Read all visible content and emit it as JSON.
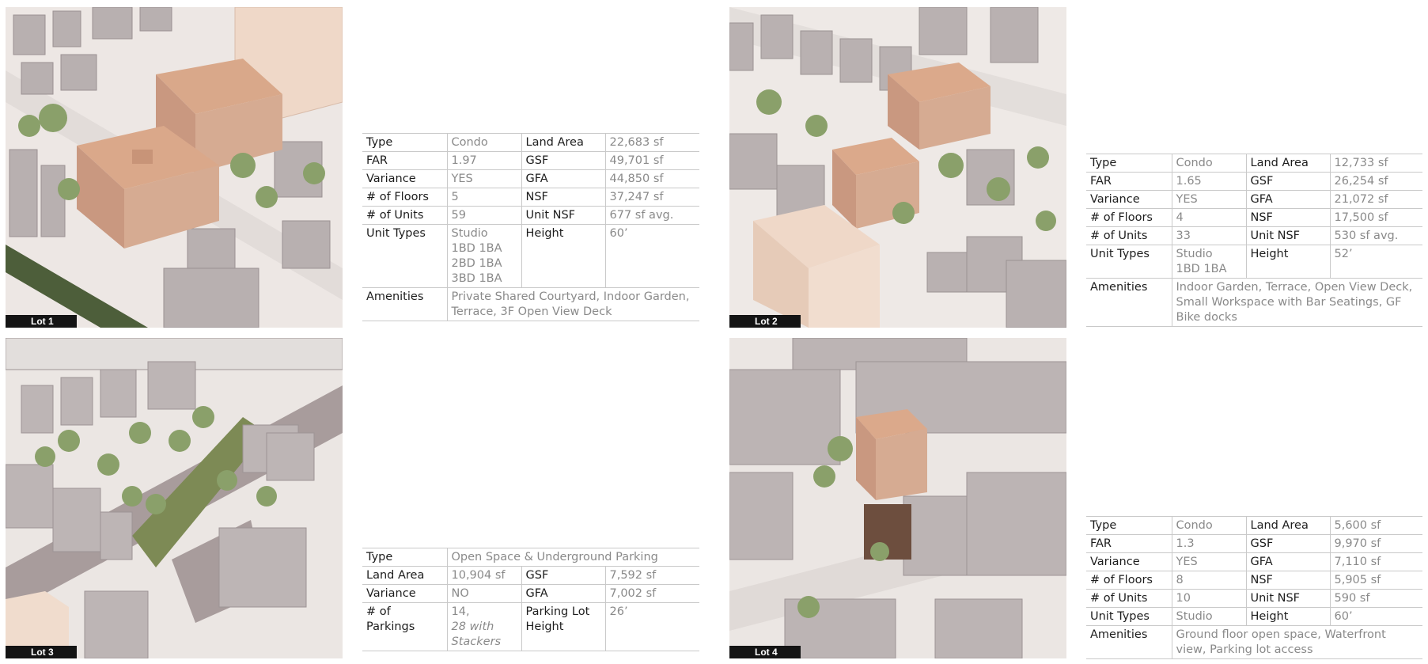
{
  "lots": [
    {
      "label": "Lot 1",
      "rows": [
        {
          "k1": "Type",
          "v1": "Condo",
          "k2": "Land Area",
          "v2": "22,683 sf"
        },
        {
          "k1": "FAR",
          "v1": "1.97",
          "k2": "GSF",
          "v2": "49,701 sf"
        },
        {
          "k1": "Variance",
          "v1": "YES",
          "k2": "GFA",
          "v2": "44,850 sf"
        },
        {
          "k1": "# of Floors",
          "v1": "5",
          "k2": "NSF",
          "v2": "37,247 sf"
        },
        {
          "k1": "# of Units",
          "v1": "59",
          "k2": "Unit NSF",
          "v2": "677 sf avg."
        }
      ],
      "unit_types_label": "Unit Types",
      "unit_types": [
        "Studio",
        "1BD 1BA",
        "2BD 1BA",
        "3BD 1BA"
      ],
      "height_label": "Height",
      "height": "60’",
      "amenities_label": "Amenities",
      "amenities": "Private Shared Courtyard, Indoor Garden, Terrace, 3F Open View Deck"
    },
    {
      "label": "Lot 2",
      "rows": [
        {
          "k1": "Type",
          "v1": "Condo",
          "k2": "Land Area",
          "v2": "12,733 sf"
        },
        {
          "k1": "FAR",
          "v1": "1.65",
          "k2": "GSF",
          "v2": "26,254 sf"
        },
        {
          "k1": "Variance",
          "v1": "YES",
          "k2": "GFA",
          "v2": "21,072 sf"
        },
        {
          "k1": "# of Floors",
          "v1": "4",
          "k2": "NSF",
          "v2": "17,500 sf"
        },
        {
          "k1": "# of Units",
          "v1": "33",
          "k2": "Unit NSF",
          "v2": "530 sf avg."
        }
      ],
      "unit_types_label": "Unit Types",
      "unit_types": [
        "Studio",
        "1BD 1BA"
      ],
      "height_label": "Height",
      "height": "52’",
      "amenities_label": "Amenities",
      "amenities": "Indoor Garden, Terrace, Open View Deck, Small Workspace with Bar Seatings, GF Bike docks"
    },
    {
      "label": "Lot 3",
      "type_label": "Type",
      "type_value": "Open Space & Underground Parking",
      "rows": [
        {
          "k1": "Land Area",
          "v1": "10,904 sf",
          "k2": "GSF",
          "v2": "7,592 sf"
        },
        {
          "k1": "Variance",
          "v1": "NO",
          "k2": "GFA",
          "v2": "7,002 sf"
        }
      ],
      "parkings_label_1": "# of",
      "parkings_label_2": "Parkings",
      "parkings_value": "14,",
      "parkings_note": "28 with Stackers",
      "plh_label": "Parking Lot Height",
      "plh_value": "26’"
    },
    {
      "label": "Lot 4",
      "rows": [
        {
          "k1": "Type",
          "v1": "Condo",
          "k2": "Land Area",
          "v2": "5,600 sf"
        },
        {
          "k1": "FAR",
          "v1": "1.3",
          "k2": "GSF",
          "v2": "9,970 sf"
        },
        {
          "k1": "Variance",
          "v1": "YES",
          "k2": "GFA",
          "v2": "7,110 sf"
        },
        {
          "k1": "# of Floors",
          "v1": "8",
          "k2": "NSF",
          "v2": "5,905 sf"
        },
        {
          "k1": "# of Units",
          "v1": "10",
          "k2": "Unit NSF",
          "v2": "590 sf"
        },
        {
          "k1": "Unit Types",
          "v1": "Studio",
          "k2": "Height",
          "v2": "60’"
        }
      ],
      "amenities_label": "Amenities",
      "amenities": "Ground floor open space, Waterfront view, Parking lot access"
    }
  ]
}
